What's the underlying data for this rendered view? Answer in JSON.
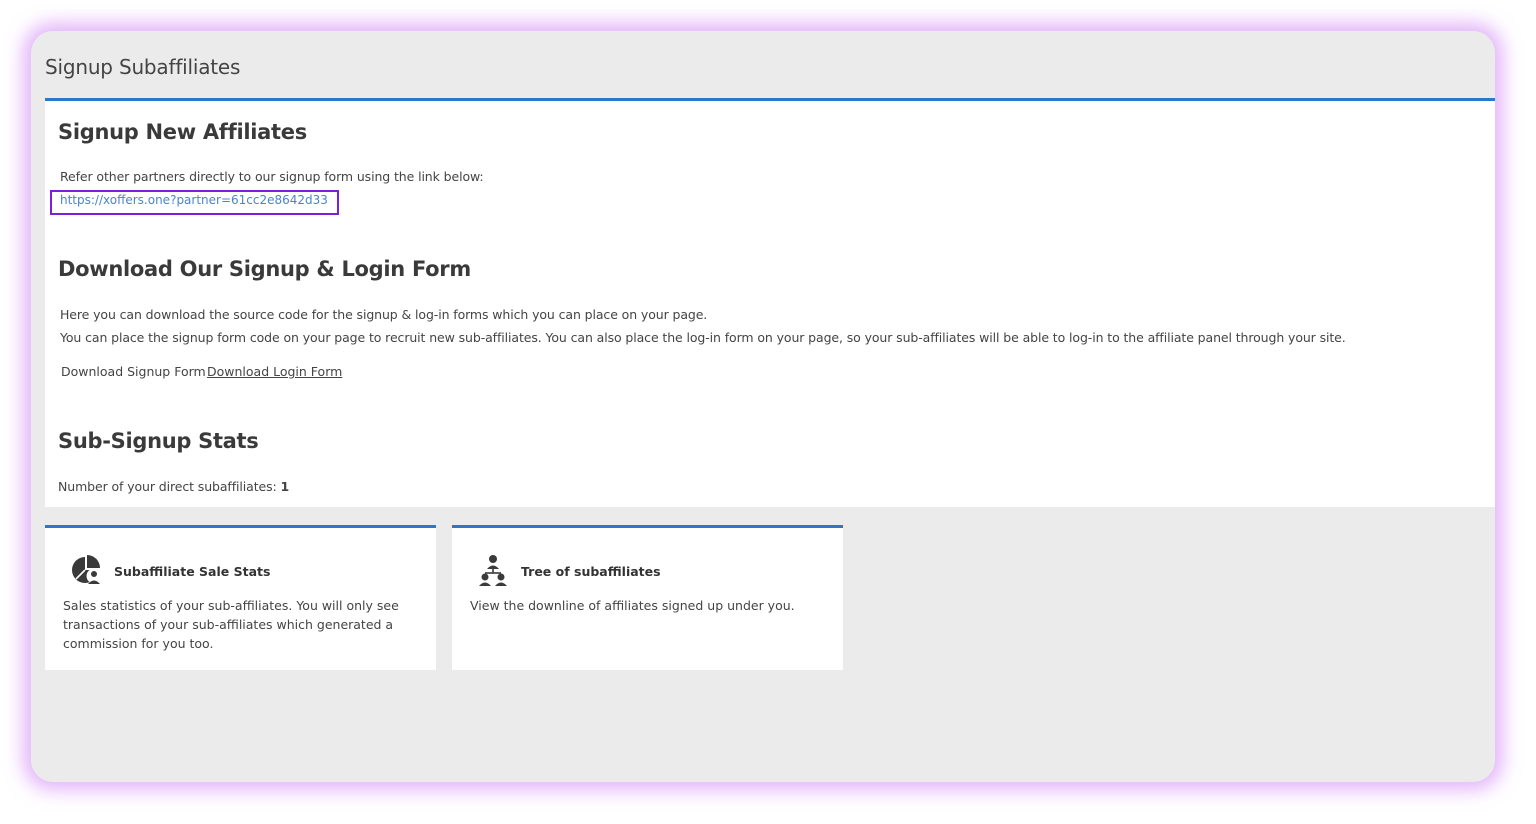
{
  "page": {
    "title": "Signup Subaffiliates"
  },
  "signup_section": {
    "heading": "Signup New Affiliates",
    "intro": "Refer other partners directly to our signup form using the link below:",
    "link": "https://xoffers.one?partner=61cc2e8642d33"
  },
  "download_section": {
    "heading": "Download Our Signup & Login Form",
    "line1": "Here you can download the source code for the signup & log-in forms which you can place on your page.",
    "line2": "You can place the signup form code on your page to recruit new sub-affiliates. You can also place the log-in form on your page, so your sub-affiliates will be able to log-in to the affiliate panel through your site.",
    "signup_label": "Download Signup Form",
    "login_label": "Download Login Form"
  },
  "stats_section": {
    "heading": "Sub-Signup Stats",
    "label": "Number of your direct subaffiliates:",
    "count": "1"
  },
  "cards": [
    {
      "icon": "pie-chart-user-icon",
      "title": "Subaffiliate Sale Stats",
      "description": "Sales statistics of your sub-affiliates. You will only see transactions of your sub-affiliates which generated a commission for you too."
    },
    {
      "icon": "user-tree-icon",
      "title": "Tree of subaffiliates",
      "description": "View the downline of affiliates signed up under you."
    }
  ],
  "colors": {
    "accent": "#2a78c8",
    "highlight_box": "#7a1fe0",
    "link": "#4a84c9",
    "panel_bg": "#ebebeb"
  }
}
